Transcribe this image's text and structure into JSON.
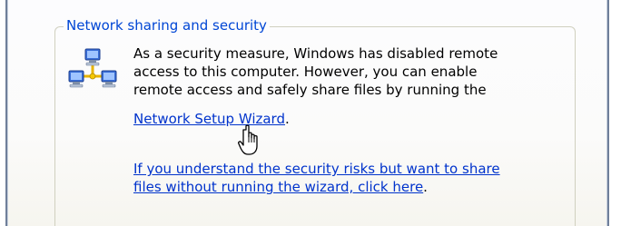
{
  "group": {
    "title": "Network sharing and security"
  },
  "description": {
    "line1": "As a security measure, Windows has disabled remote",
    "line2": "access to this computer. However, you can enable",
    "line3": "remote access and safely share files by running the"
  },
  "links": {
    "wizard_label": "Network Setup Wizard",
    "wizard_suffix": ".",
    "understand_line1": "If you understand the security risks but want to share",
    "understand_line2": "files without running the wizard, click here",
    "understand_suffix": "."
  },
  "icons": {
    "network": "network-computers-icon",
    "cursor": "hand-pointer-icon"
  },
  "colors": {
    "title": "#0046d5",
    "link": "#0033cc",
    "text": "#000000"
  }
}
